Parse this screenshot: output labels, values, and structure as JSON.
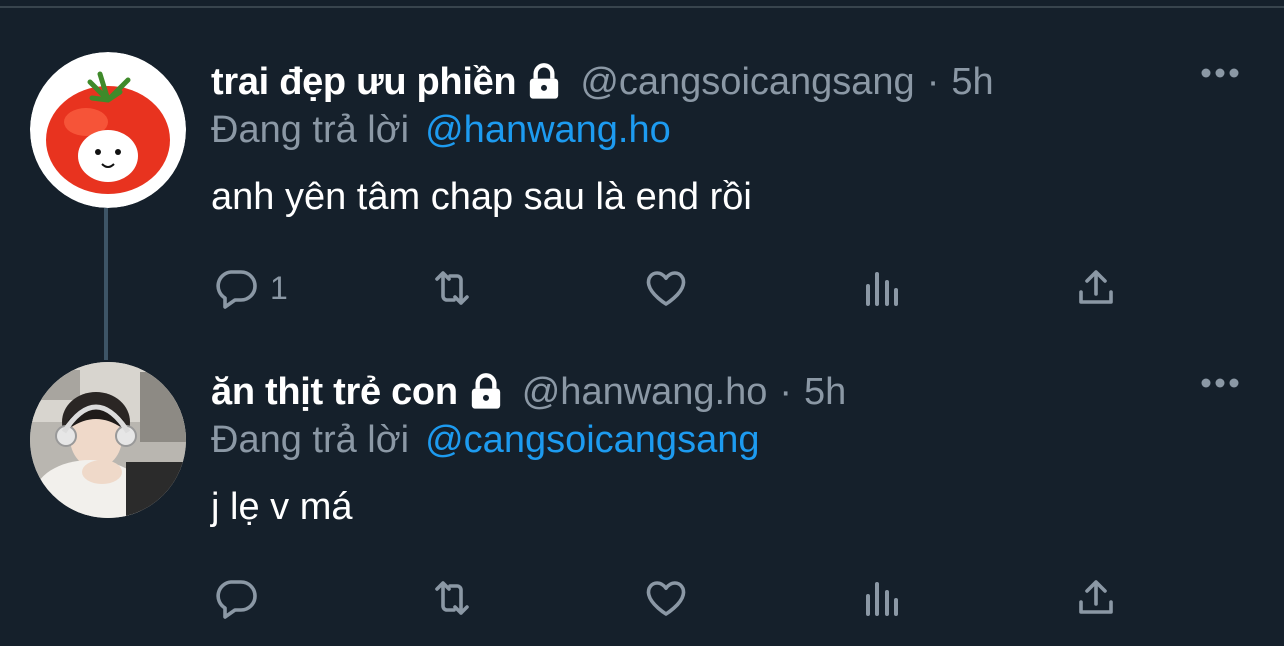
{
  "colors": {
    "background": "#15202b",
    "text_primary": "#ffffff",
    "text_secondary": "#8b98a5",
    "accent": "#1d9bf0",
    "thread_line": "#3d5466"
  },
  "tweets": [
    {
      "display_name": "trai đẹp ưu phiền",
      "protected": true,
      "handle": "@cangsoicangsang",
      "dot": "·",
      "time": "5h",
      "reply_prefix": "Đang trả lời",
      "reply_target": "@hanwang.ho",
      "text": "anh yên tâm chap sau là end rồi",
      "avatar": "tomato-face-avatar",
      "reply_count": "1"
    },
    {
      "display_name": "ăn thịt trẻ con",
      "protected": true,
      "handle": "@hanwang.ho",
      "dot": "·",
      "time": "5h",
      "reply_prefix": "Đang trả lời",
      "reply_target": "@cangsoicangsang",
      "text": "j lẹ v má",
      "avatar": "person-with-headphones-avatar",
      "reply_count": ""
    }
  ],
  "icons": {
    "lock": "lock-icon",
    "more": "more-horizontal-icon",
    "reply": "reply-bubble-icon",
    "retweet": "retweet-icon",
    "like": "heart-icon",
    "analytics": "analytics-icon",
    "share": "share-icon"
  }
}
